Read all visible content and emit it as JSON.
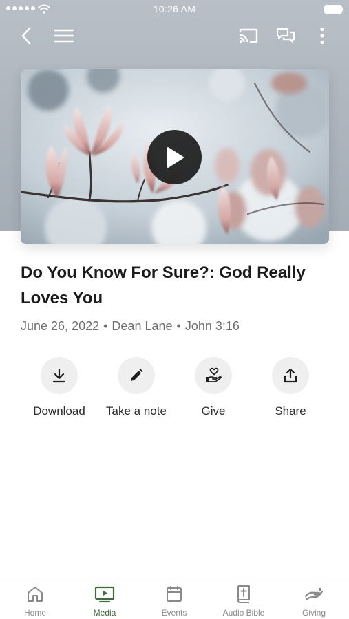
{
  "status_bar": {
    "time": "10:26 AM"
  },
  "colors": {
    "hero_background": "#a9b1ba",
    "active_tab": "#3f6b3f",
    "inactive_tab": "#8a8a8a",
    "action_circle": "#efefef"
  },
  "nav": {
    "icons": [
      "back-chevron-icon",
      "hamburger-menu-icon",
      "cast-icon",
      "chat-icon",
      "more-vertical-icon"
    ]
  },
  "video": {
    "play_icon": "play-icon"
  },
  "sermon": {
    "title": "Do You Know For Sure?: God Really Loves You",
    "date": "June 26, 2022",
    "speaker": "Dean Lane",
    "scripture": "John 3:16",
    "separator": "•"
  },
  "actions": [
    {
      "label": "Download",
      "icon": "download-icon"
    },
    {
      "label": "Take a note",
      "icon": "pencil-icon"
    },
    {
      "label": "Give",
      "icon": "give-heart-hand-icon"
    },
    {
      "label": "Share",
      "icon": "share-icon"
    }
  ],
  "tabs": [
    {
      "label": "Home",
      "icon": "home-icon",
      "active": false
    },
    {
      "label": "Media",
      "icon": "media-tv-icon",
      "active": true
    },
    {
      "label": "Events",
      "icon": "calendar-icon",
      "active": false
    },
    {
      "label": "Audio Bible",
      "icon": "bible-icon",
      "active": false
    },
    {
      "label": "Giving",
      "icon": "giving-hand-icon",
      "active": false
    }
  ]
}
